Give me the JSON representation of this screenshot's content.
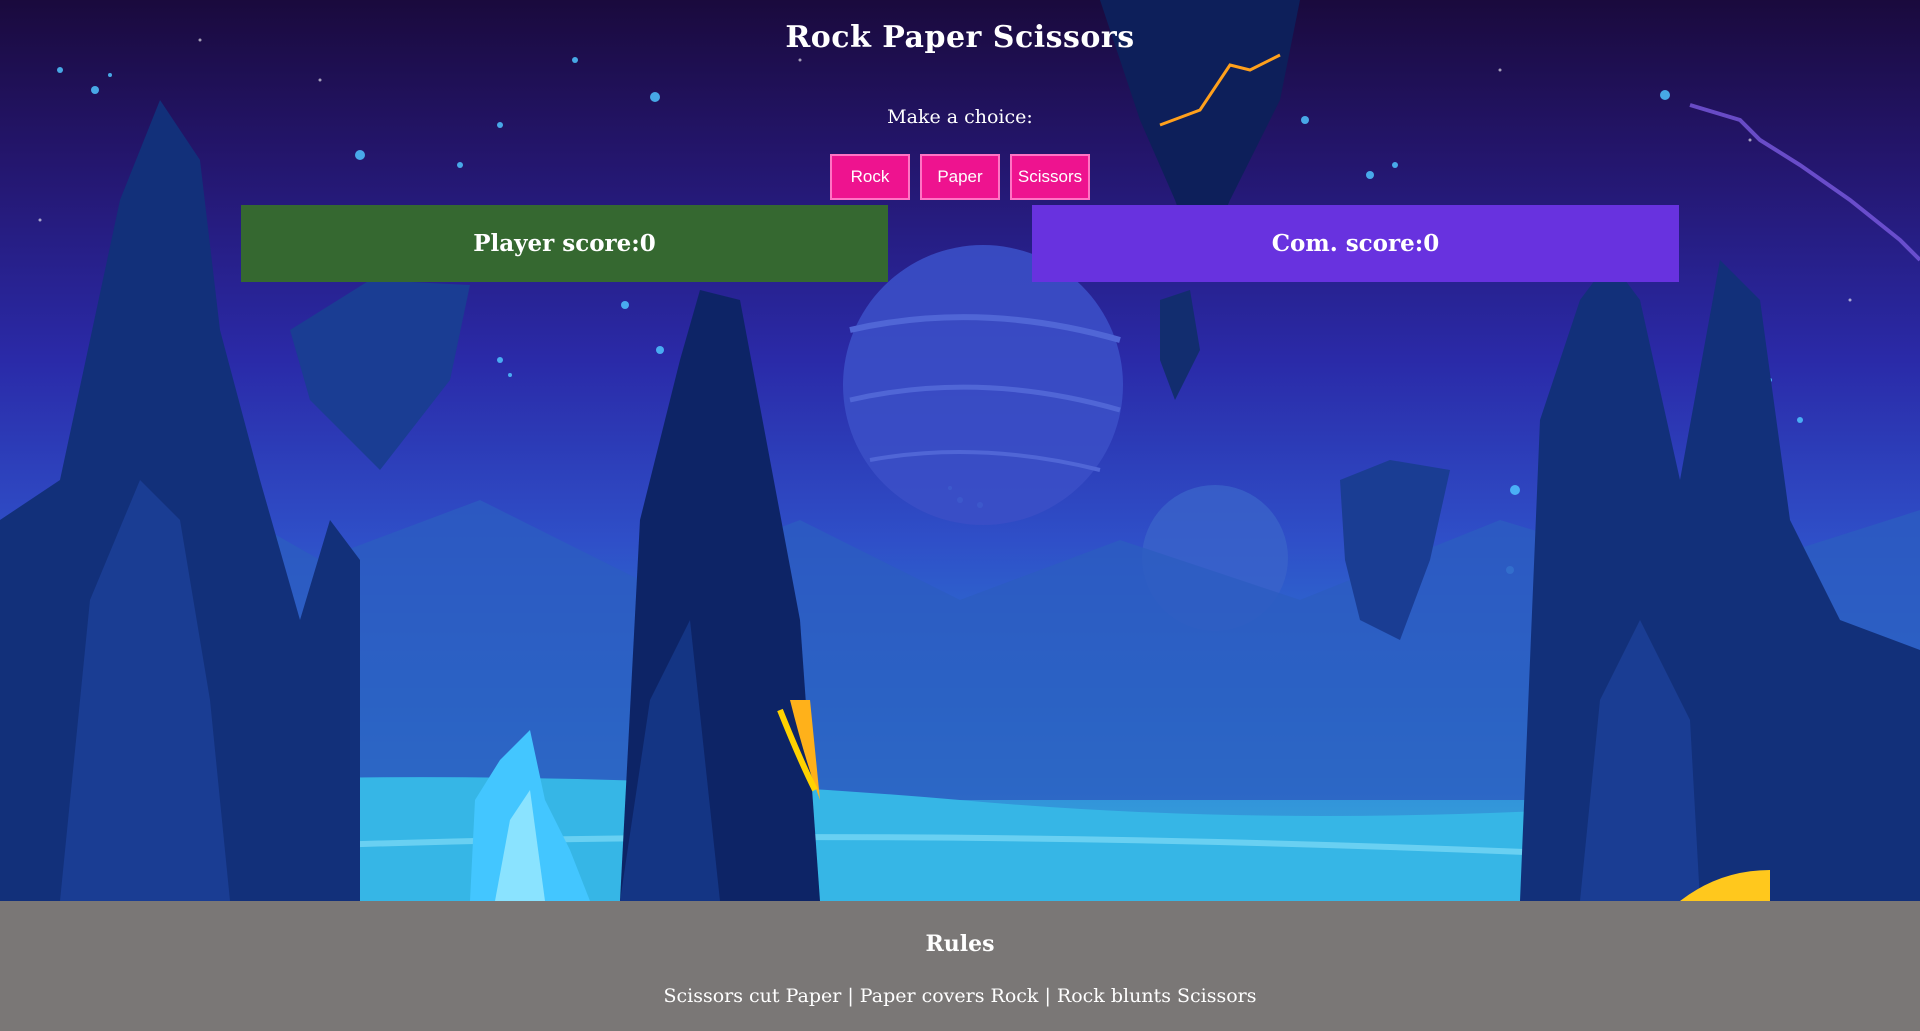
{
  "header": {
    "title": "Rock Paper Scissors",
    "prompt": "Make a choice:"
  },
  "choices": [
    {
      "label": "Rock"
    },
    {
      "label": "Paper"
    },
    {
      "label": "Scissors"
    }
  ],
  "scores": {
    "player_label": "Player score:0",
    "com_label": "Com. score:0"
  },
  "rules": {
    "title": "Rules",
    "text": "Scissors cut Paper | Paper covers Rock | Rock blunts Scissors"
  },
  "colors": {
    "button": "#ee138f",
    "player_box": "#356830",
    "com_box": "#6832df",
    "rules_bg": "#7a7776"
  }
}
